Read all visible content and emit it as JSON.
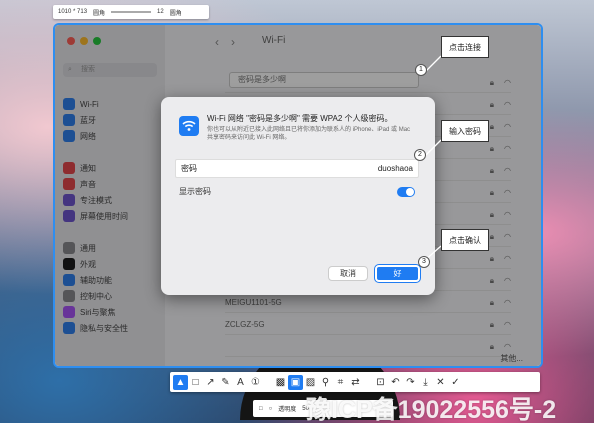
{
  "capture_toolbar": {
    "size": "1010 * 713",
    "mode": "圆角",
    "value": "12",
    "unit": "圆角"
  },
  "sidebar": {
    "search_placeholder": "搜索",
    "items": [
      {
        "label": "Wi-Fi",
        "color": "#2f80ed"
      },
      {
        "label": "蓝牙",
        "color": "#2f80ed"
      },
      {
        "label": "网络",
        "color": "#2f80ed"
      },
      {
        "label": "通知",
        "color": "#e5484d"
      },
      {
        "label": "声音",
        "color": "#e5484d"
      },
      {
        "label": "专注模式",
        "color": "#6e56cf"
      },
      {
        "label": "屏幕使用时间",
        "color": "#6e56cf"
      },
      {
        "label": "通用",
        "color": "#8a8a8e"
      },
      {
        "label": "外观",
        "color": "#1c1c1e"
      },
      {
        "label": "辅助功能",
        "color": "#2f80ed"
      },
      {
        "label": "控制中心",
        "color": "#8a8a8e"
      },
      {
        "label": "Siri与聚焦",
        "color": "#a855f7"
      },
      {
        "label": "隐私与安全性",
        "color": "#2f80ed"
      }
    ]
  },
  "content": {
    "title": "Wi-Fi",
    "password_field_top": "密码是多少啊",
    "networks": [
      {
        "name": "MEIGU1101-5G"
      },
      {
        "name": "ZCLGZ-5G"
      }
    ],
    "other_label": "其他..."
  },
  "dialog": {
    "title": "Wi-Fi 网络 \"密码是多少啊\" 需要 WPA2 个人级密码。",
    "description": "你也可以从附近已接入此网络且已将你添加为联系人的 iPhone、iPad 或 Mac 共享密码来访问此 Wi-Fi 网络。",
    "password_label": "密码",
    "password_value": "duoshaoa",
    "show_password_label": "显示密码",
    "show_password_on": true,
    "cancel_label": "取消",
    "ok_label": "好"
  },
  "annotations": [
    {
      "num": "1",
      "label": "点击连接"
    },
    {
      "num": "2",
      "label": "输入密码"
    },
    {
      "num": "3",
      "label": "点击确认"
    }
  ],
  "annotation_toolbar": {
    "tools": [
      "pointer-icon",
      "rectangle-icon",
      "arrow-icon",
      "pen-icon",
      "text-icon",
      "step-number-icon",
      "mosaic-icon",
      "highlight-icon",
      "hatch-icon",
      "pin-icon",
      "ocr-icon",
      "translate-icon",
      "crop-icon",
      "undo-icon",
      "redo-icon",
      "download-icon",
      "close-icon",
      "check-icon"
    ]
  },
  "sub_toolbar": {
    "label": "透明度",
    "value": "50"
  },
  "watermark": "豫ICP备19022556号-2",
  "colors": {
    "accent": "#1f7cf2",
    "window_border": "#2e8ef0"
  }
}
